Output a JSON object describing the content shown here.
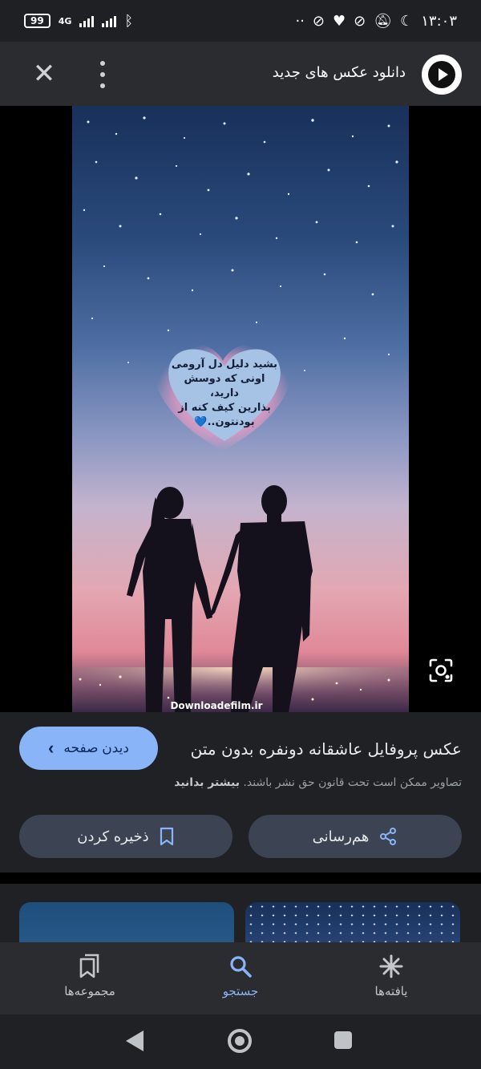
{
  "status_bar": {
    "battery": "99",
    "network": "4G",
    "time": "۱۳:۰۳"
  },
  "app_bar": {
    "title": "دانلود عکس های جدید",
    "icons": [
      "close-icon",
      "more-vert-icon",
      "site-logo"
    ]
  },
  "image": {
    "overlay_text": [
      "بشید دلیل دل آرومی",
      "اونی که دوسش",
      "دارید،",
      "بذارین کیف کنه از",
      "بودنتون..💙"
    ],
    "watermark": "Downloadefilm.ir"
  },
  "result": {
    "title": "عکس پروفایل عاشقانه دونفره بدون متن",
    "view_page_label": "دیدن صفحه",
    "copyright_text": "تصاویر ممکن است تحت قانون حق نشر باشند.",
    "learn_more": "بیشتر بدانید"
  },
  "actions": {
    "share_label": "هم‌رسانی",
    "save_label": "ذخیره کردن"
  },
  "bottom_nav": {
    "discover_label": "یافته‌ها",
    "search_label": "جستجو",
    "collections_label": "مجموعه‌ها",
    "active": "search"
  },
  "colors": {
    "accent": "#8ab4f8",
    "surface": "#202124",
    "appbar": "#2b2c30",
    "pill": "#3c4453"
  }
}
